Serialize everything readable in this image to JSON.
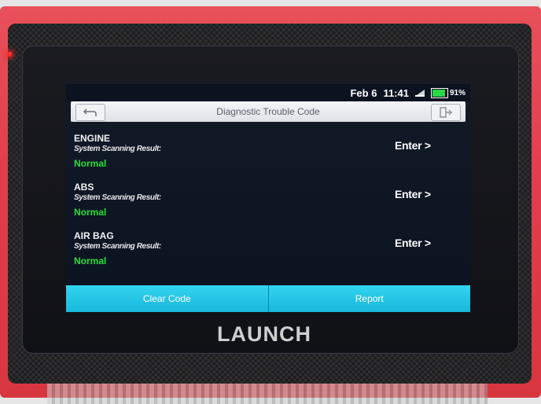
{
  "status_bar": {
    "date": "Feb 6",
    "time": "11:41",
    "battery_level": 0.91,
    "battery_text": "91%",
    "battery_color": "#2bd64a",
    "signal_icon": "signal-icon"
  },
  "title_bar": {
    "title": "Diagnostic Trouble Code",
    "back_icon": "back-arrow-icon",
    "exit_icon": "exit-icon"
  },
  "systems": [
    {
      "name": "ENGINE",
      "scan_label": "System Scanning Result:",
      "result": "Normal",
      "enter_label": "Enter >"
    },
    {
      "name": "ABS",
      "scan_label": "System Scanning Result:",
      "result": "Normal",
      "enter_label": "Enter >"
    },
    {
      "name": "AIR BAG",
      "scan_label": "System Scanning Result:",
      "result": "Normal",
      "enter_label": "Enter >"
    }
  ],
  "actions": {
    "clear_code": "Clear Code",
    "report": "Report"
  },
  "colors": {
    "accent": "#1fc6e6",
    "result_normal": "#22e03a",
    "housing": "#e0404c"
  },
  "brand": "LAUNCH"
}
